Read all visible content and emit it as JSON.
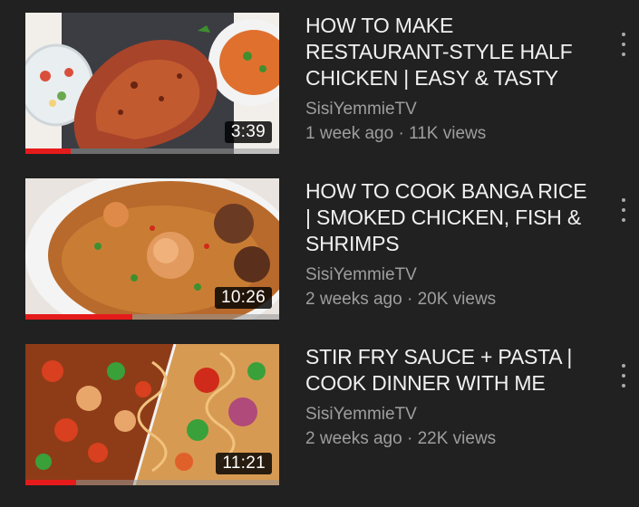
{
  "videos": [
    {
      "title": "HOW TO MAKE RESTAURANT-STYLE  HALF CHICKEN | EASY & TASTY",
      "channel": "SisiYemmieTV",
      "stats": "1 week ago · 11K views",
      "duration": "3:39",
      "watched_fraction": 0.18,
      "thumbnail": "half-chicken-with-coleslaw-and-spaghetti"
    },
    {
      "title": "HOW TO COOK BANGA RICE | SMOKED CHICKEN, FISH & SHRIMPS",
      "channel": "SisiYemmieTV",
      "stats": "2 weeks ago · 20K views",
      "duration": "10:26",
      "watched_fraction": 0.42,
      "thumbnail": "banga-rice-dish"
    },
    {
      "title": "STIR FRY SAUCE + PASTA  | COOK DINNER WITH ME",
      "channel": "SisiYemmieTV",
      "stats": "2 weeks ago · 22K views",
      "duration": "11:21",
      "watched_fraction": 0.2,
      "thumbnail": "stir-fry-sauce-and-pasta"
    }
  ],
  "colors": {
    "background": "#212121",
    "progress": "#e51b1b",
    "title": "#f1f1f1",
    "secondary": "#9e9e9e"
  },
  "icons": {
    "menu": "more-vert-icon"
  }
}
